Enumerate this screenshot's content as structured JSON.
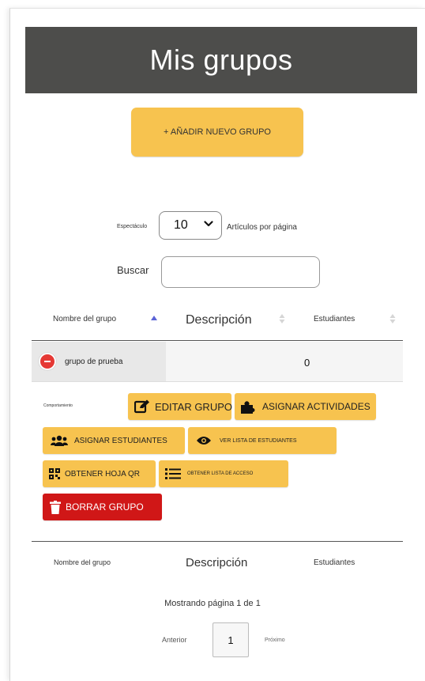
{
  "header": {
    "title": "Mis grupos"
  },
  "add_group_button": "+ AÑADIR NUEVO GRUPO",
  "pagination_controls": {
    "show_label": "Espectáculo",
    "page_size_value": "10",
    "per_page_label": "Artículos por página"
  },
  "search": {
    "label": "Buscar",
    "value": ""
  },
  "table": {
    "columns": [
      "Nombre del grupo",
      "Descripción",
      "Estudiantes"
    ],
    "rows": [
      {
        "name": "grupo de prueba",
        "description": "",
        "students": "0"
      }
    ]
  },
  "row_actions": {
    "label": "Comportamiento",
    "edit": "EDITAR GRUPO",
    "assign_activities": "ASIGNAR ACTIVIDADES",
    "assign_students": "ASIGNAR ESTUDIANTES",
    "view_students": "VER LISTA DE ESTUDIANTES",
    "qr_sheet": "OBTENER HOJA QR",
    "access_list": "OBTENER LISTA DE ACCESO",
    "delete": "BORRAR GRUPO"
  },
  "footer": {
    "page_info": "Mostrando página 1 de 1",
    "previous": "Anterior",
    "current_page": "1",
    "next": "Próximo"
  },
  "colors": {
    "header_bg": "#4d4d4b",
    "accent": "#f7c34f",
    "danger": "#d01717",
    "sort_active": "#5b63d6"
  }
}
